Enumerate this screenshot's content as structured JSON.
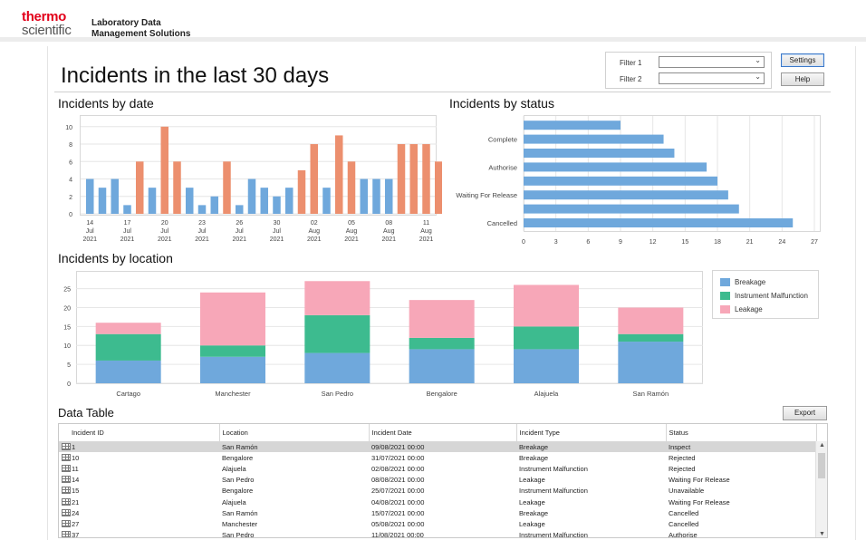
{
  "header": {
    "brand_line1": "thermo",
    "brand_line2": "scientific",
    "product_line1": "Laboratory Data",
    "product_line2": "Management Solutions"
  },
  "page": {
    "title": "Incidents in the last 30 days"
  },
  "filters": {
    "filter1_label": "Filter 1",
    "filter1_value": "",
    "filter2_label": "Filter 2",
    "filter2_value": ""
  },
  "buttons": {
    "settings": "Settings",
    "help": "Help",
    "export": "Export"
  },
  "sections": {
    "by_date": "Incidents by date",
    "by_status": "Incidents by status",
    "by_location": "Incidents by location",
    "data_table": "Data Table"
  },
  "colors": {
    "blue": "#6fa8dc",
    "orange": "#ec8f6e",
    "green": "#3dbb8f",
    "pink": "#f7a7b8"
  },
  "chart_data": [
    {
      "type": "bar",
      "title": "Incidents by date",
      "ylim": [
        0,
        11
      ],
      "yticks": [
        0,
        2,
        4,
        6,
        8,
        10
      ],
      "grid": true,
      "values": [
        4,
        3,
        4,
        1,
        6,
        3,
        10,
        6,
        3,
        1,
        2,
        6,
        1,
        4,
        3,
        2,
        3,
        5,
        8,
        3,
        9,
        6,
        4,
        4,
        4,
        8,
        8,
        8,
        6
      ],
      "highlight": [
        false,
        false,
        false,
        false,
        true,
        false,
        true,
        true,
        false,
        false,
        false,
        true,
        false,
        false,
        false,
        false,
        false,
        true,
        true,
        false,
        true,
        true,
        false,
        false,
        false,
        true,
        true,
        true,
        true
      ],
      "tick_labels": [
        {
          "index": 0,
          "lines": [
            "14",
            "Jul",
            "2021"
          ]
        },
        {
          "index": 3,
          "lines": [
            "17",
            "Jul",
            "2021"
          ]
        },
        {
          "index": 6,
          "lines": [
            "20",
            "Jul",
            "2021"
          ]
        },
        {
          "index": 9,
          "lines": [
            "23",
            "Jul",
            "2021"
          ]
        },
        {
          "index": 12,
          "lines": [
            "26",
            "Jul",
            "2021"
          ]
        },
        {
          "index": 15,
          "lines": [
            "30",
            "Jul",
            "2021"
          ]
        },
        {
          "index": 18,
          "lines": [
            "02",
            "Aug",
            "2021"
          ]
        },
        {
          "index": 21,
          "lines": [
            "05",
            "Aug",
            "2021"
          ]
        },
        {
          "index": 24,
          "lines": [
            "08",
            "Aug",
            "2021"
          ]
        },
        {
          "index": 27,
          "lines": [
            "11",
            "Aug",
            "2021"
          ]
        }
      ]
    },
    {
      "type": "bar",
      "orientation": "horizontal",
      "title": "Incidents by status",
      "xlim": [
        0,
        27
      ],
      "xticks": [
        0,
        3,
        6,
        9,
        12,
        15,
        18,
        21,
        24,
        27
      ],
      "grid": true,
      "categories": [
        "Cancelled",
        "",
        "Waiting For Release",
        "",
        "Authorise",
        "",
        "Complete",
        ""
      ],
      "values": [
        25,
        20,
        19,
        18,
        17,
        14,
        13,
        9
      ]
    },
    {
      "type": "bar",
      "stacked": true,
      "title": "Incidents by location",
      "ylim": [
        0,
        28
      ],
      "yticks": [
        0,
        5,
        10,
        15,
        20,
        25
      ],
      "grid": true,
      "legend_position": "right",
      "categories": [
        "Cartago",
        "Manchester",
        "San Pedro",
        "Bengalore",
        "Alajuela",
        "San Ramón"
      ],
      "series": [
        {
          "name": "Breakage",
          "values": [
            6,
            7,
            8,
            9,
            9,
            11
          ]
        },
        {
          "name": "Instrument Malfunction",
          "values": [
            7,
            3,
            10,
            3,
            6,
            2
          ]
        },
        {
          "name": "Leakage",
          "values": [
            3,
            14,
            9,
            10,
            11,
            7
          ]
        }
      ]
    }
  ],
  "table": {
    "columns": [
      "Incident ID",
      "Location",
      "Incident Date",
      "Incident Type",
      "Status"
    ],
    "rows": [
      [
        "1",
        "San Ramón",
        "09/08/2021 00:00",
        "Breakage",
        "Inspect"
      ],
      [
        "10",
        "Bengalore",
        "31/07/2021 00:00",
        "Breakage",
        "Rejected"
      ],
      [
        "11",
        "Alajuela",
        "02/08/2021 00:00",
        "Instrument Malfunction",
        "Rejected"
      ],
      [
        "14",
        "San Pedro",
        "08/08/2021 00:00",
        "Leakage",
        "Waiting For Release"
      ],
      [
        "15",
        "Bengalore",
        "25/07/2021 00:00",
        "Instrument Malfunction",
        "Unavailable"
      ],
      [
        "21",
        "Alajuela",
        "04/08/2021 00:00",
        "Leakage",
        "Waiting For Release"
      ],
      [
        "24",
        "San Ramón",
        "15/07/2021 00:00",
        "Breakage",
        "Cancelled"
      ],
      [
        "27",
        "Manchester",
        "05/08/2021 00:00",
        "Leakage",
        "Cancelled"
      ],
      [
        "37",
        "San Pedro",
        "11/08/2021 00:00",
        "Instrument Malfunction",
        "Authorise"
      ]
    ],
    "selected_row": 0
  }
}
